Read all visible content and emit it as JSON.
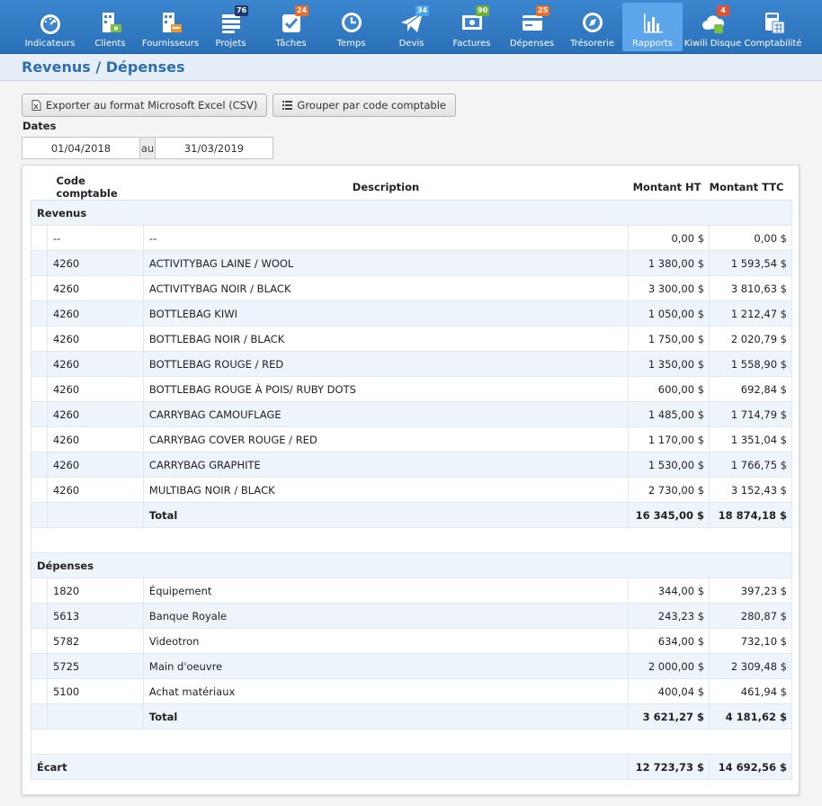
{
  "nav": [
    {
      "label": "Indicateurs",
      "icon": "gauge-icon",
      "badge": "",
      "badge_color": ""
    },
    {
      "label": "Clients",
      "icon": "clients-icon",
      "badge": "",
      "badge_color": ""
    },
    {
      "label": "Fournisseurs",
      "icon": "suppliers-icon",
      "badge": "",
      "badge_color": ""
    },
    {
      "label": "Projets",
      "icon": "projects-icon",
      "badge": "76",
      "badge_color": "navy"
    },
    {
      "label": "Tâches",
      "icon": "tasks-icon",
      "badge": "24",
      "badge_color": "orange"
    },
    {
      "label": "Temps",
      "icon": "clock-icon",
      "badge": "",
      "badge_color": ""
    },
    {
      "label": "Devis",
      "icon": "paper-plane-icon",
      "badge": "34",
      "badge_color": "lblue"
    },
    {
      "label": "Factures",
      "icon": "invoice-icon",
      "badge": "90",
      "badge_color": "green"
    },
    {
      "label": "Dépenses",
      "icon": "credit-card-icon",
      "badge": "25",
      "badge_color": "orange"
    },
    {
      "label": "Trésorerie",
      "icon": "compass-icon",
      "badge": "",
      "badge_color": ""
    },
    {
      "label": "Rapports",
      "icon": "bar-chart-icon",
      "badge": "",
      "badge_color": "",
      "active": true
    },
    {
      "label": "Kiwili Disque",
      "icon": "cloud-icon",
      "badge": "4",
      "badge_color": "red"
    },
    {
      "label": "Comptabilité",
      "icon": "calculator-icon",
      "badge": "",
      "badge_color": ""
    }
  ],
  "page": {
    "title": "Revenus / Dépenses"
  },
  "toolbar": {
    "export_label": "Exporter au format Microsoft Excel (CSV)",
    "group_label": "Grouper par code comptable"
  },
  "dates": {
    "label": "Dates",
    "from": "01/04/2018",
    "separator": "au",
    "to": "31/03/2019"
  },
  "table": {
    "headers": {
      "code": "Code comptable",
      "description": "Description",
      "ht": "Montant HT",
      "ttc": "Montant TTC"
    },
    "revenus": {
      "title": "Revenus",
      "rows": [
        {
          "code": "--",
          "description": "--",
          "ht": "0,00 $",
          "ttc": "0,00 $"
        },
        {
          "code": "4260",
          "description": "ACTIVITYBAG LAINE / WOOL",
          "ht": "1 380,00 $",
          "ttc": "1 593,54 $"
        },
        {
          "code": "4260",
          "description": "ACTIVITYBAG NOIR / BLACK",
          "ht": "3 300,00 $",
          "ttc": "3 810,63 $"
        },
        {
          "code": "4260",
          "description": "BOTTLEBAG KIWI",
          "ht": "1 050,00 $",
          "ttc": "1 212,47 $"
        },
        {
          "code": "4260",
          "description": "BOTTLEBAG NOIR / BLACK",
          "ht": "1 750,00 $",
          "ttc": "2 020,79 $"
        },
        {
          "code": "4260",
          "description": "BOTTLEBAG ROUGE / RED",
          "ht": "1 350,00 $",
          "ttc": "1 558,90 $"
        },
        {
          "code": "4260",
          "description": "BOTTLEBAG ROUGE À POIS/ RUBY DOTS",
          "ht": "600,00 $",
          "ttc": "692,84 $"
        },
        {
          "code": "4260",
          "description": "CARRYBAG CAMOUFLAGE",
          "ht": "1 485,00 $",
          "ttc": "1 714,79 $"
        },
        {
          "code": "4260",
          "description": "CARRYBAG COVER ROUGE / RED",
          "ht": "1 170,00 $",
          "ttc": "1 351,04 $"
        },
        {
          "code": "4260",
          "description": "CARRYBAG GRAPHITE",
          "ht": "1 530,00 $",
          "ttc": "1 766,75 $"
        },
        {
          "code": "4260",
          "description": "MULTIBAG NOIR / BLACK",
          "ht": "2 730,00 $",
          "ttc": "3 152,43 $"
        }
      ],
      "total": {
        "label": "Total",
        "ht": "16 345,00 $",
        "ttc": "18 874,18 $"
      }
    },
    "depenses": {
      "title": "Dépenses",
      "rows": [
        {
          "code": "1820",
          "description": "Équipement",
          "ht": "344,00 $",
          "ttc": "397,23 $"
        },
        {
          "code": "5613",
          "description": "Banque Royale",
          "ht": "243,23 $",
          "ttc": "280,87 $"
        },
        {
          "code": "5782",
          "description": "Videotron",
          "ht": "634,00 $",
          "ttc": "732,10 $"
        },
        {
          "code": "5725",
          "description": "Main d'oeuvre",
          "ht": "2 000,00 $",
          "ttc": "2 309,48 $"
        },
        {
          "code": "5100",
          "description": "Achat matériaux",
          "ht": "400,04 $",
          "ttc": "461,94 $"
        }
      ],
      "total": {
        "label": "Total",
        "ht": "3 621,27 $",
        "ttc": "4 181,62 $"
      }
    },
    "ecart": {
      "label": "Écart",
      "ht": "12 723,73 $",
      "ttc": "14 692,56 $"
    }
  }
}
